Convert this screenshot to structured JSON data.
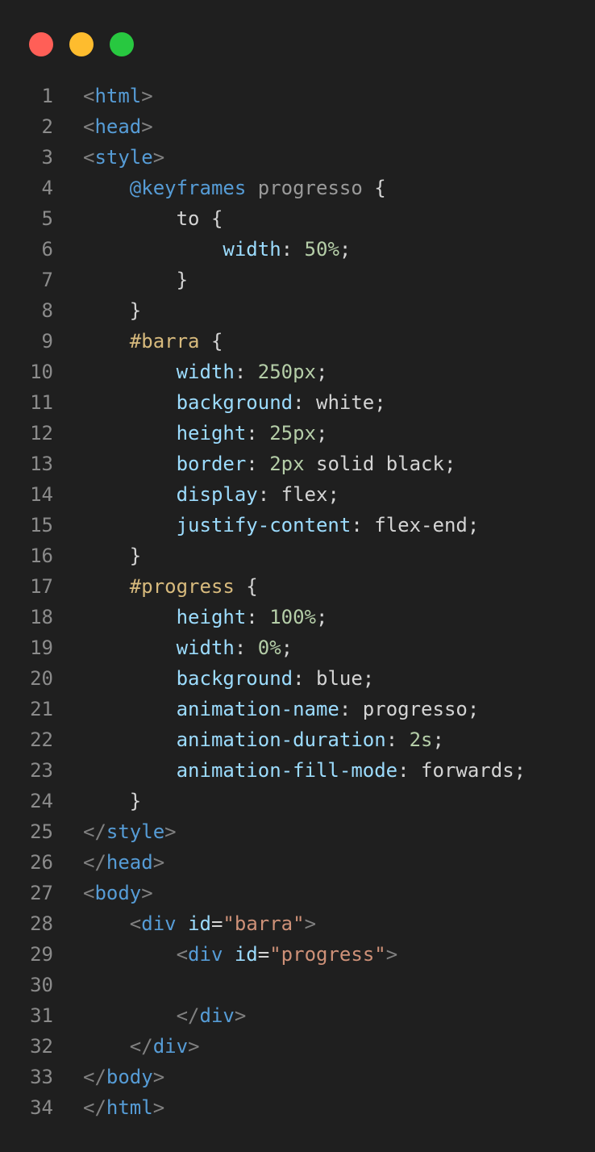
{
  "window": {
    "controls": [
      {
        "name": "close",
        "color": "#ff5f57"
      },
      {
        "name": "minimize",
        "color": "#febc2e"
      },
      {
        "name": "maximize",
        "color": "#28c840"
      }
    ]
  },
  "editor": {
    "lines": [
      {
        "n": "1",
        "tokens": [
          [
            "punct",
            "<"
          ],
          [
            "tag",
            "html"
          ],
          [
            "punct",
            ">"
          ]
        ]
      },
      {
        "n": "2",
        "tokens": [
          [
            "punct",
            "<"
          ],
          [
            "tag",
            "head"
          ],
          [
            "punct",
            ">"
          ]
        ]
      },
      {
        "n": "3",
        "tokens": [
          [
            "punct",
            "<"
          ],
          [
            "tag",
            "style"
          ],
          [
            "punct",
            ">"
          ]
        ]
      },
      {
        "n": "4",
        "tokens": [
          [
            "plain",
            "    "
          ],
          [
            "at",
            "@keyframes"
          ],
          [
            "plain",
            " "
          ],
          [
            "kfname",
            "progresso"
          ],
          [
            "plain",
            " {"
          ]
        ]
      },
      {
        "n": "5",
        "tokens": [
          [
            "plain",
            "        to {"
          ]
        ]
      },
      {
        "n": "6",
        "tokens": [
          [
            "plain",
            "            "
          ],
          [
            "prop",
            "width"
          ],
          [
            "plain",
            ": "
          ],
          [
            "num",
            "50%"
          ],
          [
            "plain",
            ";"
          ]
        ]
      },
      {
        "n": "7",
        "tokens": [
          [
            "plain",
            "        }"
          ]
        ]
      },
      {
        "n": "8",
        "tokens": [
          [
            "plain",
            "    }"
          ]
        ]
      },
      {
        "n": "9",
        "tokens": [
          [
            "plain",
            "    "
          ],
          [
            "sel",
            "#barra"
          ],
          [
            "plain",
            " {"
          ]
        ]
      },
      {
        "n": "10",
        "tokens": [
          [
            "plain",
            "        "
          ],
          [
            "prop",
            "width"
          ],
          [
            "plain",
            ": "
          ],
          [
            "num",
            "250px"
          ],
          [
            "plain",
            ";"
          ]
        ]
      },
      {
        "n": "11",
        "tokens": [
          [
            "plain",
            "        "
          ],
          [
            "prop",
            "background"
          ],
          [
            "plain",
            ": "
          ],
          [
            "val",
            "white"
          ],
          [
            "plain",
            ";"
          ]
        ]
      },
      {
        "n": "12",
        "tokens": [
          [
            "plain",
            "        "
          ],
          [
            "prop",
            "height"
          ],
          [
            "plain",
            ": "
          ],
          [
            "num",
            "25px"
          ],
          [
            "plain",
            ";"
          ]
        ]
      },
      {
        "n": "13",
        "tokens": [
          [
            "plain",
            "        "
          ],
          [
            "prop",
            "border"
          ],
          [
            "plain",
            ": "
          ],
          [
            "num",
            "2px"
          ],
          [
            "plain",
            " "
          ],
          [
            "val",
            "solid black"
          ],
          [
            "plain",
            ";"
          ]
        ]
      },
      {
        "n": "14",
        "tokens": [
          [
            "plain",
            "        "
          ],
          [
            "prop",
            "display"
          ],
          [
            "plain",
            ": "
          ],
          [
            "val",
            "flex"
          ],
          [
            "plain",
            ";"
          ]
        ]
      },
      {
        "n": "15",
        "tokens": [
          [
            "plain",
            "        "
          ],
          [
            "prop",
            "justify-content"
          ],
          [
            "plain",
            ": "
          ],
          [
            "val",
            "flex-end"
          ],
          [
            "plain",
            ";"
          ]
        ]
      },
      {
        "n": "16",
        "tokens": [
          [
            "plain",
            "    }"
          ]
        ]
      },
      {
        "n": "17",
        "tokens": [
          [
            "plain",
            "    "
          ],
          [
            "sel",
            "#progress"
          ],
          [
            "plain",
            " {"
          ]
        ]
      },
      {
        "n": "18",
        "tokens": [
          [
            "plain",
            "        "
          ],
          [
            "prop",
            "height"
          ],
          [
            "plain",
            ": "
          ],
          [
            "num",
            "100%"
          ],
          [
            "plain",
            ";"
          ]
        ]
      },
      {
        "n": "19",
        "tokens": [
          [
            "plain",
            "        "
          ],
          [
            "prop",
            "width"
          ],
          [
            "plain",
            ": "
          ],
          [
            "num",
            "0%"
          ],
          [
            "plain",
            ";"
          ]
        ]
      },
      {
        "n": "20",
        "tokens": [
          [
            "plain",
            "        "
          ],
          [
            "prop",
            "background"
          ],
          [
            "plain",
            ": "
          ],
          [
            "val",
            "blue"
          ],
          [
            "plain",
            ";"
          ]
        ]
      },
      {
        "n": "21",
        "tokens": [
          [
            "plain",
            "        "
          ],
          [
            "prop",
            "animation-name"
          ],
          [
            "plain",
            ": "
          ],
          [
            "val",
            "progresso"
          ],
          [
            "plain",
            ";"
          ]
        ]
      },
      {
        "n": "22",
        "tokens": [
          [
            "plain",
            "        "
          ],
          [
            "prop",
            "animation-duration"
          ],
          [
            "plain",
            ": "
          ],
          [
            "num",
            "2s"
          ],
          [
            "plain",
            ";"
          ]
        ]
      },
      {
        "n": "23",
        "tokens": [
          [
            "plain",
            "        "
          ],
          [
            "prop",
            "animation-fill-mode"
          ],
          [
            "plain",
            ": "
          ],
          [
            "val",
            "forwards"
          ],
          [
            "plain",
            ";"
          ]
        ]
      },
      {
        "n": "24",
        "tokens": [
          [
            "plain",
            "    }"
          ]
        ]
      },
      {
        "n": "25",
        "tokens": [
          [
            "punct",
            "</"
          ],
          [
            "tag",
            "style"
          ],
          [
            "punct",
            ">"
          ]
        ]
      },
      {
        "n": "26",
        "tokens": [
          [
            "punct",
            "</"
          ],
          [
            "tag",
            "head"
          ],
          [
            "punct",
            ">"
          ]
        ]
      },
      {
        "n": "27",
        "tokens": [
          [
            "punct",
            "<"
          ],
          [
            "tag",
            "body"
          ],
          [
            "punct",
            ">"
          ]
        ]
      },
      {
        "n": "28",
        "tokens": [
          [
            "plain",
            "    "
          ],
          [
            "punct",
            "<"
          ],
          [
            "tag",
            "div"
          ],
          [
            "plain",
            " "
          ],
          [
            "attr",
            "id"
          ],
          [
            "plain",
            "="
          ],
          [
            "str",
            "\"barra\""
          ],
          [
            "punct",
            ">"
          ]
        ]
      },
      {
        "n": "29",
        "tokens": [
          [
            "plain",
            "        "
          ],
          [
            "punct",
            "<"
          ],
          [
            "tag",
            "div"
          ],
          [
            "plain",
            " "
          ],
          [
            "attr",
            "id"
          ],
          [
            "plain",
            "="
          ],
          [
            "str",
            "\"progress\""
          ],
          [
            "punct",
            ">"
          ]
        ]
      },
      {
        "n": "30",
        "tokens": []
      },
      {
        "n": "31",
        "tokens": [
          [
            "plain",
            "        "
          ],
          [
            "punct",
            "</"
          ],
          [
            "tag",
            "div"
          ],
          [
            "punct",
            ">"
          ]
        ]
      },
      {
        "n": "32",
        "tokens": [
          [
            "plain",
            "    "
          ],
          [
            "punct",
            "</"
          ],
          [
            "tag",
            "div"
          ],
          [
            "punct",
            ">"
          ]
        ]
      },
      {
        "n": "33",
        "tokens": [
          [
            "punct",
            "</"
          ],
          [
            "tag",
            "body"
          ],
          [
            "punct",
            ">"
          ]
        ]
      },
      {
        "n": "34",
        "tokens": [
          [
            "punct",
            "</"
          ],
          [
            "tag",
            "html"
          ],
          [
            "punct",
            ">"
          ]
        ]
      }
    ]
  }
}
